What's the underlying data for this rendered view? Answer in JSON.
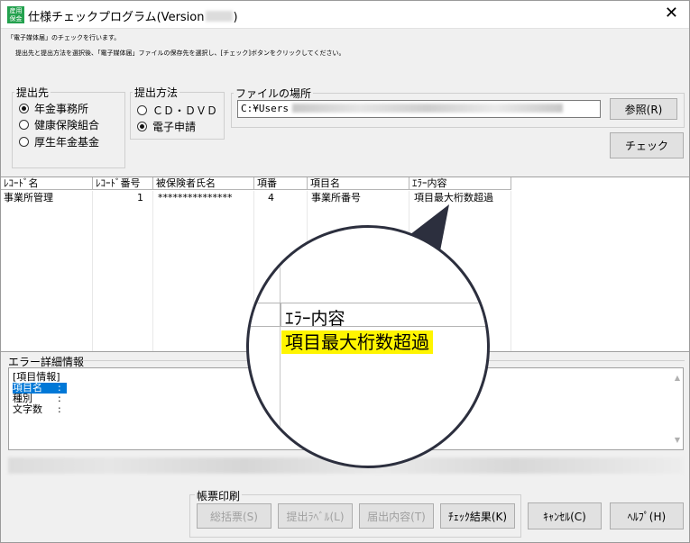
{
  "window": {
    "app_icon_text": "産用 保金",
    "title": "仕様チェックプログラム(Version",
    "title_suffix": ")",
    "close_glyph": "✕"
  },
  "intro": {
    "line1": "「電子媒体届」のチェックを行います。",
    "line2": "提出先と提出方法を選択後、「電子媒体届」ファイルの保存先を選択し、[チェック]ボタンをクリックしてください。"
  },
  "submit_to": {
    "legend": "提出先",
    "options": [
      "年金事務所",
      "健康保険組合",
      "厚生年金基金"
    ],
    "selected": "年金事務所"
  },
  "submit_method": {
    "legend": "提出方法",
    "options": [
      "ＣＤ・ＤＶＤ",
      "電子申請"
    ],
    "selected": "電子申請"
  },
  "file_location": {
    "legend": "ファイルの場所",
    "path": "C:¥Users",
    "browse_label": "参照(R)"
  },
  "check_button_label": "チェック",
  "table": {
    "headers": [
      "ﾚｺｰﾄﾞ名",
      "ﾚｺｰﾄﾞ番号",
      "被保険者氏名",
      "項番",
      "項目名",
      "ｴﾗｰ内容"
    ],
    "rows": [
      [
        "事業所管理",
        "1",
        "***************",
        "4",
        "事業所番号",
        "項目最大桁数超過"
      ]
    ]
  },
  "magnifier": {
    "header": "ｴﾗｰ内容",
    "value": "項目最大桁数超過"
  },
  "error_detail": {
    "label": "エラー詳細情報",
    "section": "[項目情報]",
    "fields": [
      {
        "name": "項目名",
        "sep": ":"
      },
      {
        "name": "種別",
        "sep": ":"
      },
      {
        "name": "文字数",
        "sep": ":"
      }
    ]
  },
  "print": {
    "legend": "帳票印刷",
    "buttons": [
      "総括票(S)",
      "提出ﾗﾍﾞﾙ(L)",
      "届出内容(T)",
      "ﾁｪｯｸ結果(K)"
    ]
  },
  "cancel_label": "ｷｬﾝｾﾙ(C)",
  "help_label": "ﾍﾙﾌﾟ(H)",
  "colors": {
    "highlight": "#fff500",
    "selection": "#0078d7",
    "lens_border": "#2c2f3e",
    "icon_green": "#23a14e"
  }
}
